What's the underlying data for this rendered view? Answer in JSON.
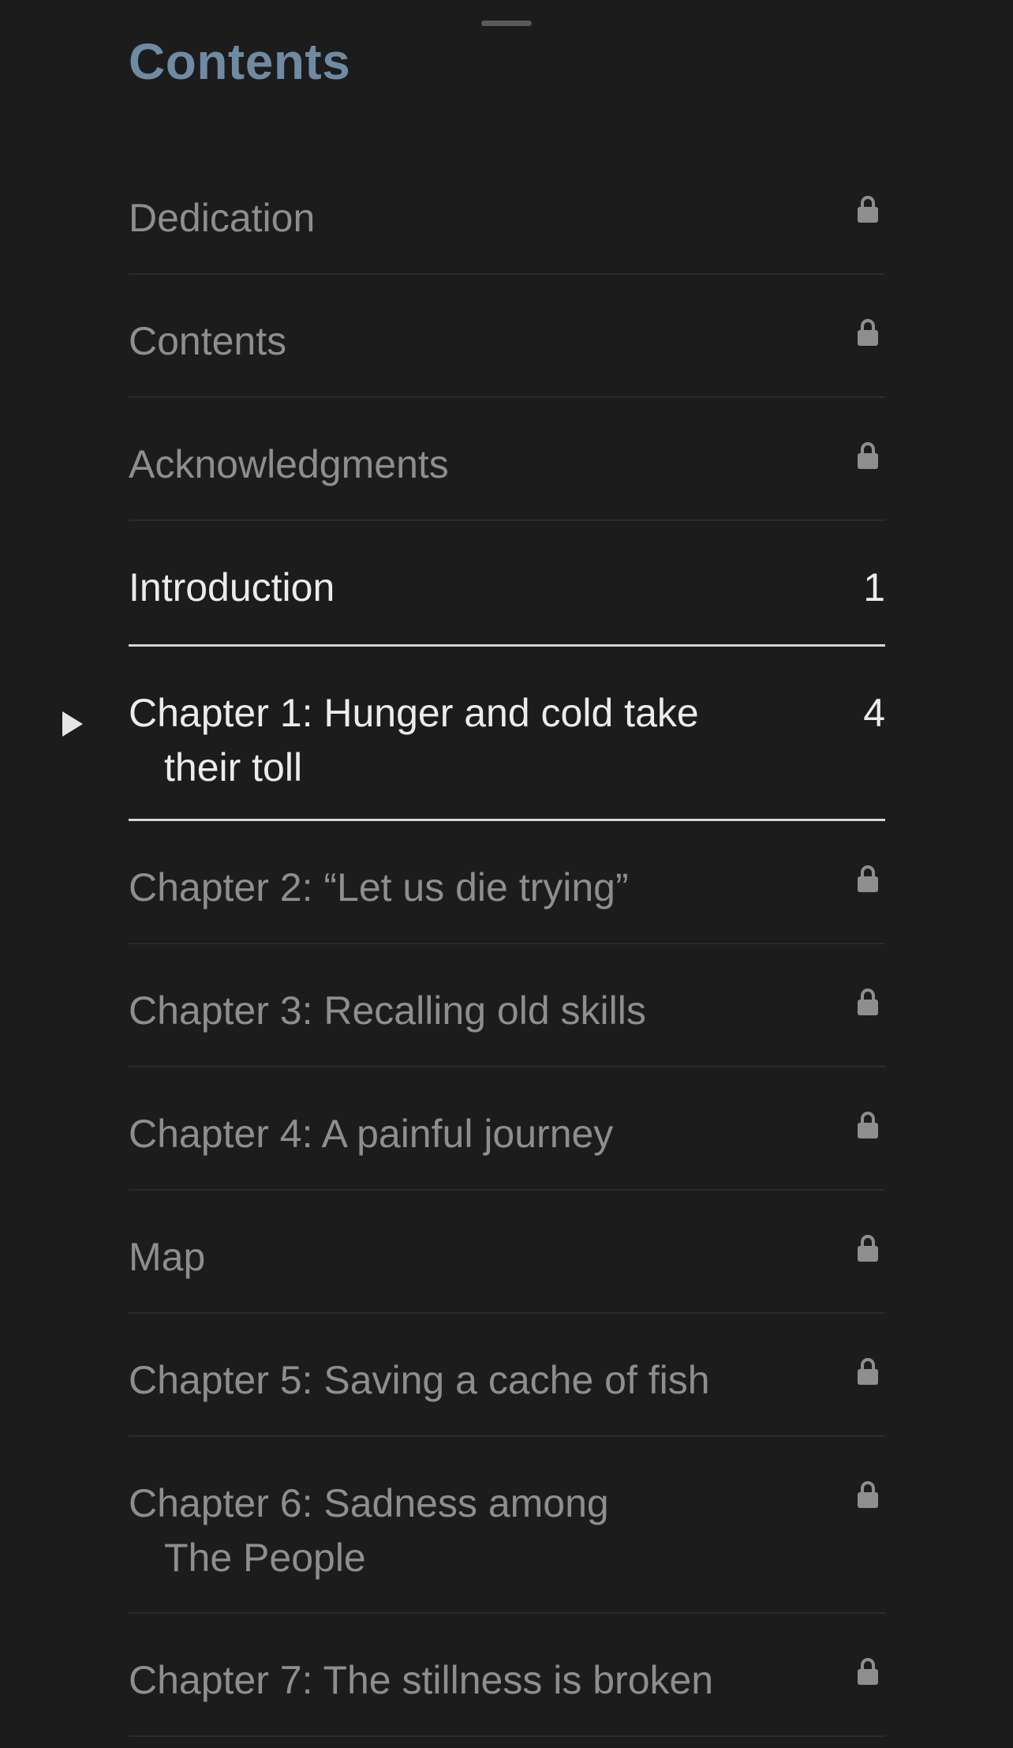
{
  "header": {
    "title": "Contents"
  },
  "colors": {
    "background": "#1c1c1c",
    "title": "#6f8aa3",
    "locked_text": "#8e8e8e",
    "unlocked_text": "#ececec",
    "lock_icon": "#8e8e8e"
  },
  "toc": {
    "items": [
      {
        "line1": "Dedication",
        "line2": "",
        "locked": true,
        "page": ""
      },
      {
        "line1": "Contents",
        "line2": "",
        "locked": true,
        "page": ""
      },
      {
        "line1": "Acknowledgments",
        "line2": "",
        "locked": true,
        "page": ""
      },
      {
        "line1": "Introduction",
        "line2": "",
        "locked": false,
        "page": "1"
      },
      {
        "line1": "Chapter 1: Hunger and cold take",
        "line2": "their toll",
        "locked": false,
        "page": "4",
        "current": true
      },
      {
        "line1": "Chapter 2: “Let us die trying”",
        "line2": "",
        "locked": true,
        "page": ""
      },
      {
        "line1": "Chapter 3: Recalling old skills",
        "line2": "",
        "locked": true,
        "page": ""
      },
      {
        "line1": "Chapter 4: A painful journey",
        "line2": "",
        "locked": true,
        "page": ""
      },
      {
        "line1": "Map",
        "line2": "",
        "locked": true,
        "page": ""
      },
      {
        "line1": "Chapter 5: Saving a cache of fish",
        "line2": "",
        "locked": true,
        "page": ""
      },
      {
        "line1": "Chapter 6: Sadness among",
        "line2": "The People",
        "locked": true,
        "page": ""
      },
      {
        "line1": "Chapter 7: The stillness is broken",
        "line2": "",
        "locked": true,
        "page": ""
      }
    ]
  },
  "icons": {
    "lock": "lock-icon",
    "current_marker": "play-triangle-icon",
    "grabber": "sheet-grabber"
  }
}
